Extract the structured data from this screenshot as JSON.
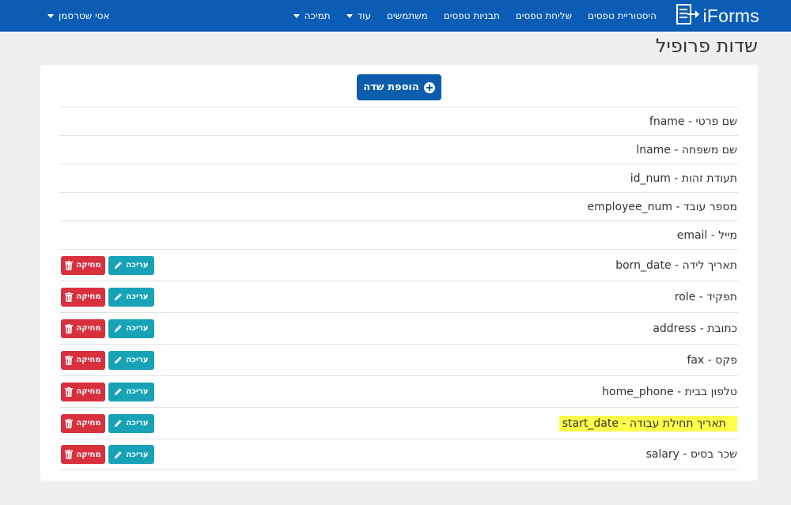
{
  "brand": {
    "name": "iForms"
  },
  "nav": {
    "items": [
      {
        "label": "היסטוריית טפסים",
        "dropdown": false
      },
      {
        "label": "שליחת טפסים",
        "dropdown": false
      },
      {
        "label": "תבניות טפסים",
        "dropdown": false
      },
      {
        "label": "משתמשים",
        "dropdown": false
      },
      {
        "label": "עוד",
        "dropdown": true
      },
      {
        "label": "תמיכה",
        "dropdown": true
      }
    ],
    "user": "אסי שטרסמן"
  },
  "page": {
    "title": "שדות פרופיל"
  },
  "toolbar": {
    "add_label": "הוספת שדה"
  },
  "fields": [
    {
      "label": "שם פרטי - fname",
      "editable": false
    },
    {
      "label": "שם משפחה - lname",
      "editable": false
    },
    {
      "label": "תעודת זהות - id_num",
      "editable": false
    },
    {
      "label": "מספר עובד - employee_num",
      "editable": false
    },
    {
      "label": "מייל - email",
      "editable": false
    },
    {
      "label": "תאריך לידה - born_date",
      "editable": true
    },
    {
      "label": "תפקיד - role",
      "editable": true
    },
    {
      "label": "כתובת - address",
      "editable": true
    },
    {
      "label": "פקס - fax",
      "editable": true
    },
    {
      "label": "טלפון בבית - home_phone",
      "editable": true
    },
    {
      "label": "תאריך תחילת עבודה - start_date",
      "editable": true,
      "highlighted": true
    },
    {
      "label": "שכר בסיס - salary",
      "editable": true
    }
  ],
  "actions": {
    "edit_label": "עריכה",
    "delete_label": "מחיקה"
  },
  "colors": {
    "navbar": "#0a5cb5",
    "primary_button": "#0b5cad",
    "edit_button": "#17a2b8",
    "delete_button": "#d9303e",
    "highlight": "#fdfd4a"
  }
}
